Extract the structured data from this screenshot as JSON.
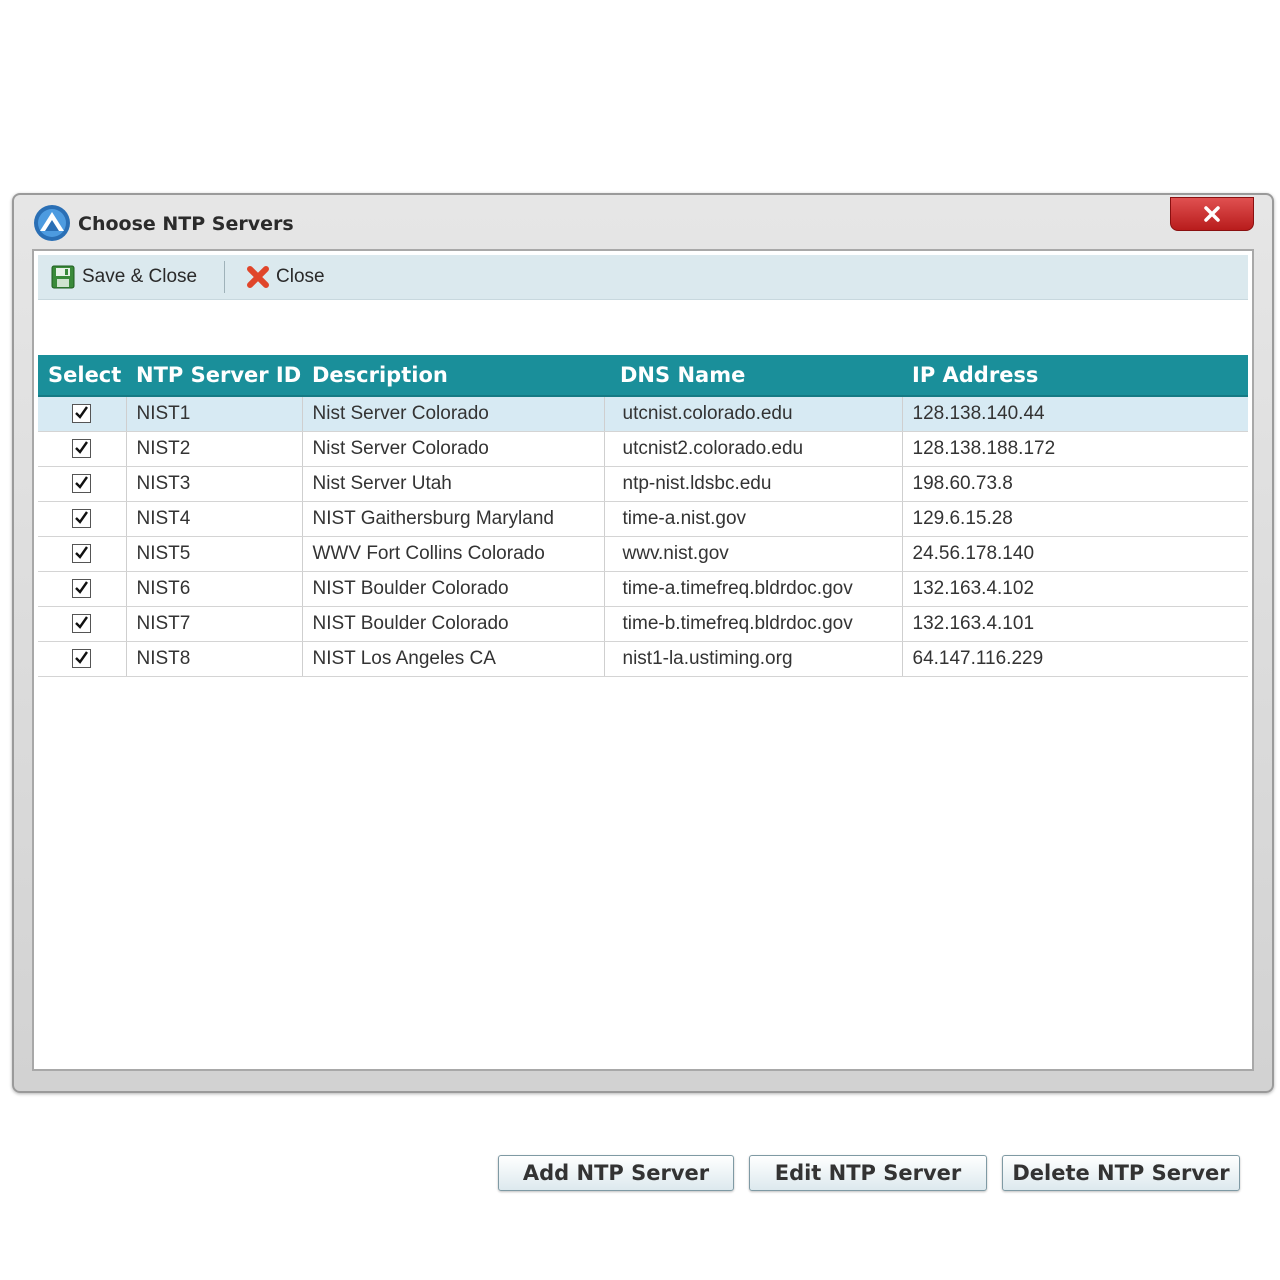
{
  "window": {
    "title": "Choose NTP Servers",
    "app_icon": "app-logo-icon",
    "close_icon": "close-icon"
  },
  "toolbar": {
    "save_close": {
      "label": "Save & Close",
      "icon": "save-icon"
    },
    "close": {
      "label": "Close",
      "icon": "delete-x-icon"
    }
  },
  "table": {
    "headers": [
      "Select",
      "NTP Server ID",
      "Description",
      "DNS Name",
      "IP Address"
    ],
    "rows": [
      {
        "checked": true,
        "id": "NIST1",
        "description": "Nist Server Colorado",
        "dns": "utcnist.colorado.edu",
        "ip": "128.138.140.44"
      },
      {
        "checked": true,
        "id": "NIST2",
        "description": "Nist Server Colorado",
        "dns": "utcnist2.colorado.edu",
        "ip": "128.138.188.172"
      },
      {
        "checked": true,
        "id": "NIST3",
        "description": "Nist Server Utah",
        "dns": "ntp-nist.ldsbc.edu",
        "ip": "198.60.73.8"
      },
      {
        "checked": true,
        "id": "NIST4",
        "description": "NIST Gaithersburg Maryland",
        "dns": "time-a.nist.gov",
        "ip": "129.6.15.28"
      },
      {
        "checked": true,
        "id": "NIST5",
        "description": "WWV Fort Collins Colorado",
        "dns": "wwv.nist.gov",
        "ip": "24.56.178.140"
      },
      {
        "checked": true,
        "id": "NIST6",
        "description": "NIST Boulder Colorado",
        "dns": "time-a.timefreq.bldrdoc.gov",
        "ip": "132.163.4.102"
      },
      {
        "checked": true,
        "id": "NIST7",
        "description": "NIST Boulder Colorado",
        "dns": "time-b.timefreq.bldrdoc.gov",
        "ip": "132.163.4.101"
      },
      {
        "checked": true,
        "id": "NIST8",
        "description": "NIST Los Angeles CA",
        "dns": "nist1-la.ustiming.org",
        "ip": "64.147.116.229"
      }
    ]
  },
  "buttons": {
    "add": "Add NTP Server",
    "edit": "Edit NTP Server",
    "delete": "Delete NTP Server"
  },
  "colors": {
    "header_teal": "#1a8f9a",
    "toolbar_bg": "#dbe9ee",
    "selected_row": "#d7eaf3",
    "close_red": "#c62828"
  }
}
